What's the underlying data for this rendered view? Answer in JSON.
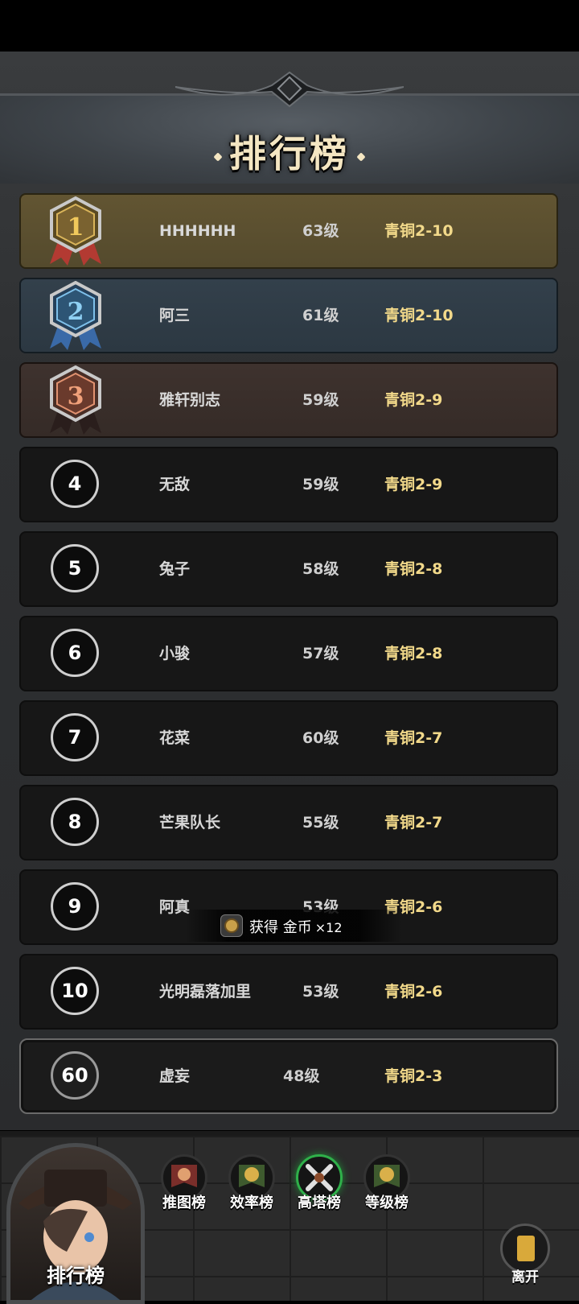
{
  "title": "排行榜",
  "rankings": [
    {
      "rank": "1",
      "name": "HHHHHH",
      "level": "63级",
      "stage": "青铜2-10"
    },
    {
      "rank": "2",
      "name": "阿三",
      "level": "61级",
      "stage": "青铜2-10"
    },
    {
      "rank": "3",
      "name": "雅轩别志",
      "level": "59级",
      "stage": "青铜2-9"
    },
    {
      "rank": "4",
      "name": "无敌",
      "level": "59级",
      "stage": "青铜2-9"
    },
    {
      "rank": "5",
      "name": "兔子",
      "level": "58级",
      "stage": "青铜2-8"
    },
    {
      "rank": "6",
      "name": "小骏",
      "level": "57级",
      "stage": "青铜2-8"
    },
    {
      "rank": "7",
      "name": "花菜",
      "level": "60级",
      "stage": "青铜2-7"
    },
    {
      "rank": "8",
      "name": "芒果队长",
      "level": "55级",
      "stage": "青铜2-7"
    },
    {
      "rank": "9",
      "name": "阿真",
      "level": "53级",
      "stage": "青铜2-6"
    },
    {
      "rank": "10",
      "name": "光明磊落加里",
      "level": "53级",
      "stage": "青铜2-6"
    }
  ],
  "my_rank": {
    "rank": "60",
    "name": "虚妄",
    "level": "48级",
    "stage": "青铜2-3"
  },
  "toast": {
    "text": "获得 金币",
    "count": "×12"
  },
  "portrait_label": "排行榜",
  "tabs": [
    {
      "label": "推图榜",
      "icon": "pig-banner-icon"
    },
    {
      "label": "效率榜",
      "icon": "clock-coin-icon"
    },
    {
      "label": "高塔榜",
      "icon": "crossed-swords-icon",
      "active": true
    },
    {
      "label": "等级榜",
      "icon": "clock-coin-icon"
    }
  ],
  "leave_label": "离开",
  "colors": {
    "gold": "#f2d98a",
    "first_row": "#5c4f2f",
    "second_row": "#2f3b45",
    "third_row": "#3a2f2b",
    "active_tab": "#2fb04a"
  }
}
